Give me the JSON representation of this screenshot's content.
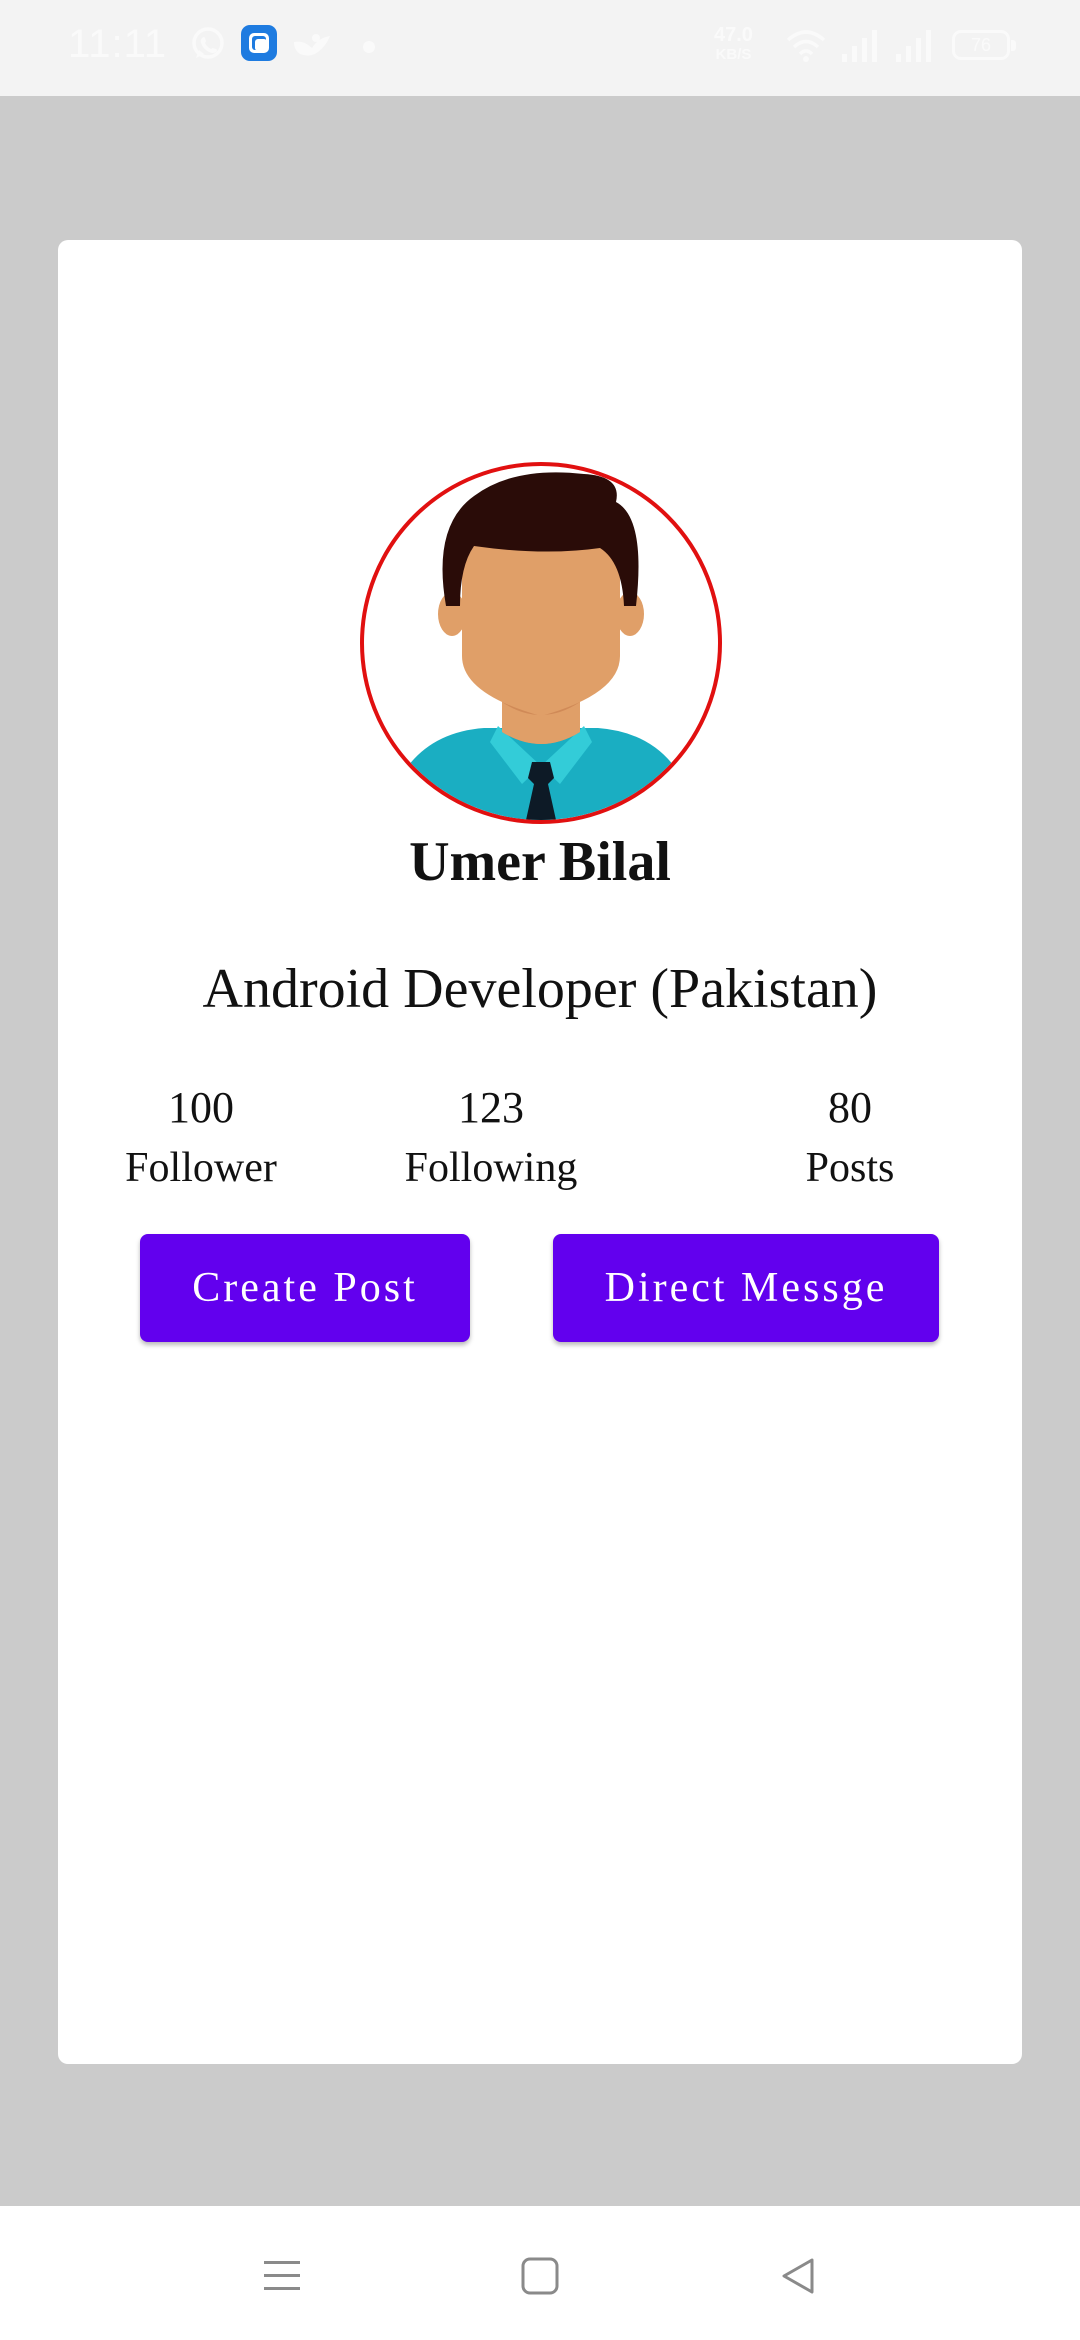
{
  "status_bar": {
    "time": "11:11",
    "net_speed": "47.0",
    "net_unit": "KB/S",
    "battery": "76",
    "icons": [
      "whatsapp-icon",
      "app-icon",
      "bird-icon",
      "dot-icon",
      "wifi-icon",
      "signal-icon",
      "signal-icon",
      "battery-icon"
    ]
  },
  "profile": {
    "name": "Umer Bilal",
    "role": "Android Developer (Pakistan)",
    "stats": [
      {
        "value": "100",
        "label": "Follower"
      },
      {
        "value": "123",
        "label": "Following"
      },
      {
        "value": "80",
        "label": "Posts"
      }
    ],
    "create_post_label": "Create Post",
    "direct_message_label": "Direct Messge"
  },
  "colors": {
    "accent": "#6200ee",
    "avatar_border": "#e11010",
    "background": "#cbcbcb",
    "card": "#ffffff"
  },
  "nav_bar": {
    "icons": [
      "menu-icon",
      "home-icon",
      "back-icon"
    ]
  }
}
